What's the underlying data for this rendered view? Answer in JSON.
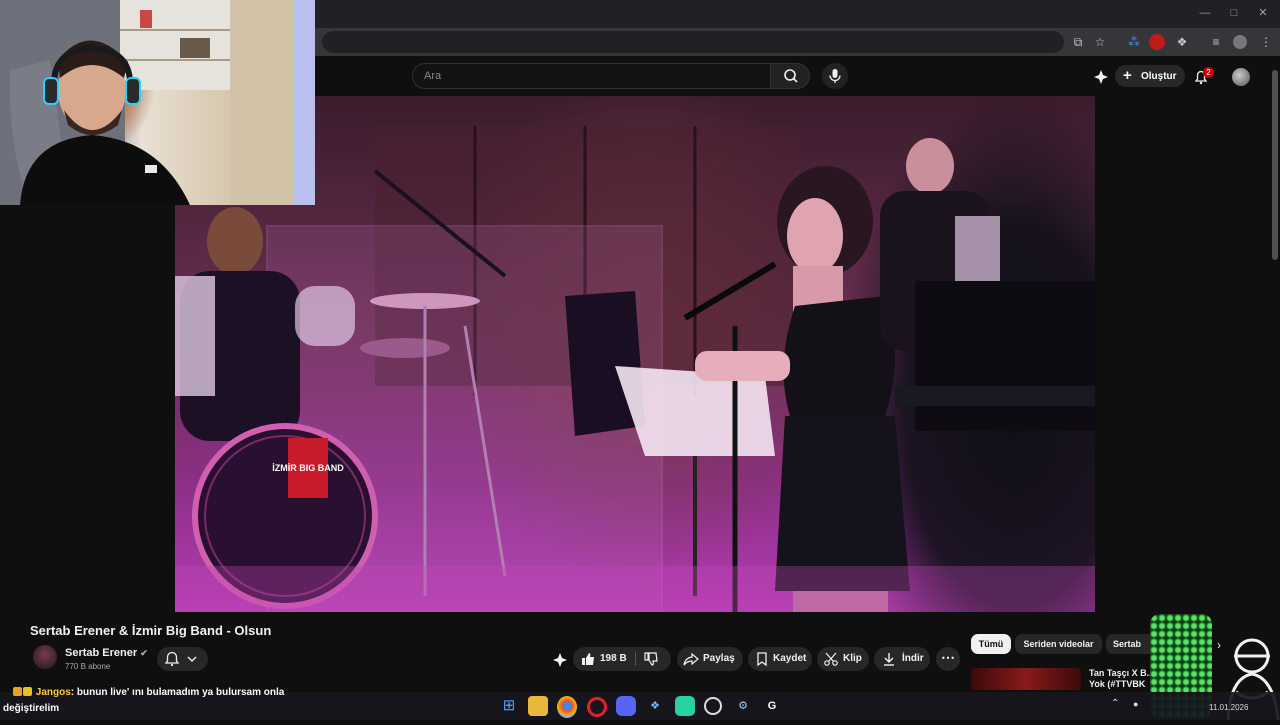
{
  "youtube": {
    "search_placeholder": "Ara",
    "create_label": "Oluştur",
    "notification_count": "2"
  },
  "video": {
    "title": "Sertab Erener & İzmir Big Band - Olsun",
    "bass_drum_label": "İZMİR BIG BAND"
  },
  "channel": {
    "name": "Sertab Erener",
    "subscribers": "770 B abone"
  },
  "actions": {
    "likes": "198 B",
    "share": "Paylaş",
    "save": "Kaydet",
    "clip": "Klip",
    "download": "İndir"
  },
  "sidebar": {
    "chips": [
      "Tümü",
      "Seriden videolar",
      "Sertab"
    ],
    "recommendation_title": "Tan Taşçı X B... Yok (#TTVBK"
  },
  "chat": {
    "user": "Jangos",
    "message_line1": ": bunun live' ını bulamadım ya bulursam onla",
    "message_line2": "değiştirelim"
  },
  "taskbar": {
    "apps": [
      "windows-start",
      "file-explorer",
      "chrome",
      "opera",
      "discord",
      "app-5",
      "app-6",
      "app-7",
      "steam",
      "app-9"
    ],
    "date": "11.01.2026"
  },
  "colors": {
    "background": "#0f0f0f",
    "accent_red": "#cc0000",
    "chat_username": "#ffcc33",
    "stage_magenta": "#b43cb4"
  }
}
